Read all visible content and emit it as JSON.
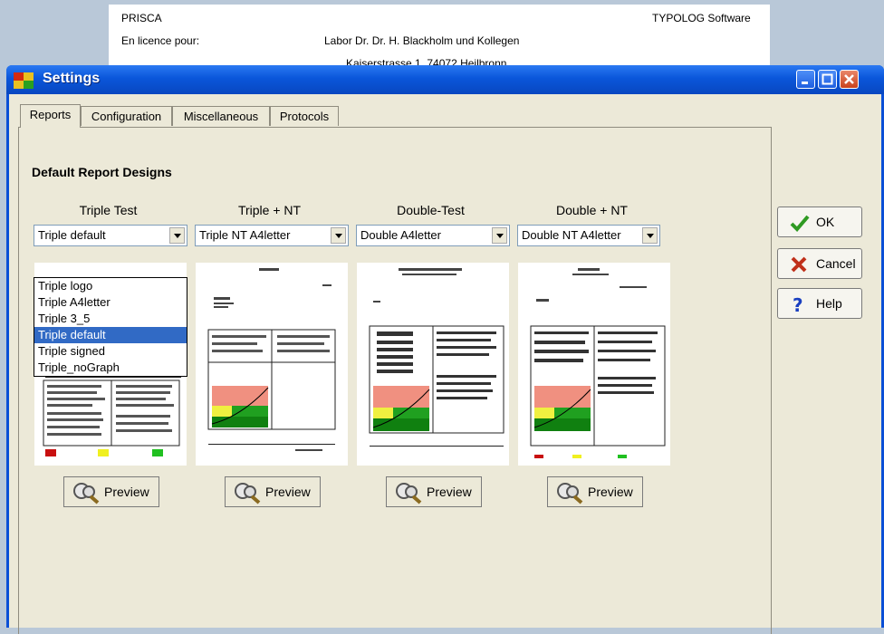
{
  "background_doc": {
    "line1_left": "PRISCA",
    "line1_right": "TYPOLOG Software",
    "line2_left": "En licence pour:",
    "line2_center": "Labor Dr. Dr. H. Blackholm und Kollegen",
    "line3_center": "Kaiserstrasse 1, 74072 Heilbronn"
  },
  "window": {
    "title": "Settings"
  },
  "tabs": [
    {
      "label": "Reports",
      "active": true
    },
    {
      "label": "Configuration",
      "active": false
    },
    {
      "label": "Miscellaneous",
      "active": false
    },
    {
      "label": "Protocols",
      "active": false
    }
  ],
  "section_title": "Default Report Designs",
  "columns": [
    {
      "title": "Triple Test",
      "selected": "Triple default",
      "preview_label": "Preview"
    },
    {
      "title": "Triple + NT",
      "selected": "Triple NT A4letter",
      "preview_label": "Preview"
    },
    {
      "title": "Double-Test",
      "selected": "Double A4letter",
      "preview_label": "Preview"
    },
    {
      "title": "Double + NT",
      "selected": "Double NT A4letter",
      "preview_label": "Preview"
    }
  ],
  "dropdown_options": [
    "Triple logo",
    "Triple A4letter",
    "Triple 3_5",
    "Triple default",
    "Triple signed",
    "Triple_noGraph"
  ],
  "dropdown_selected_index": 3,
  "buttons": {
    "ok": "OK",
    "cancel": "Cancel",
    "help": "Help"
  },
  "colors": {
    "titlebar": "#0a56da",
    "selection": "#316ac5",
    "ok_check": "#2f9a22",
    "cancel_x": "#c0301a",
    "help_q": "#1a3fc0"
  }
}
